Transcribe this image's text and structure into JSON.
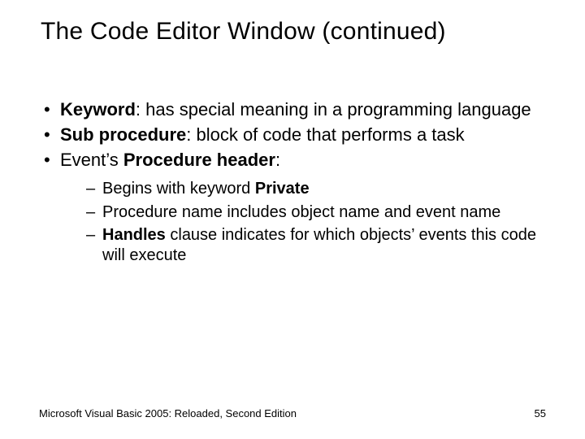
{
  "title": "The Code Editor Window (continued)",
  "bullets": [
    {
      "term": "Keyword",
      "rest": ": has special meaning in a programming language"
    },
    {
      "term": "Sub procedure",
      "rest": ": block of code that performs a task"
    },
    {
      "prefix": "Event’s ",
      "term": "Procedure header",
      "rest": ":"
    }
  ],
  "sub": [
    {
      "pre": "Begins with keyword ",
      "bold": "Private",
      "post": ""
    },
    {
      "pre": "Procedure name includes object name and event name",
      "bold": "",
      "post": ""
    },
    {
      "pre": "",
      "bold": "Handles",
      "post": " clause indicates for which objects’ events this code will execute"
    }
  ],
  "footer": {
    "left": "Microsoft Visual Basic 2005: Reloaded, Second Edition",
    "page": "55"
  }
}
